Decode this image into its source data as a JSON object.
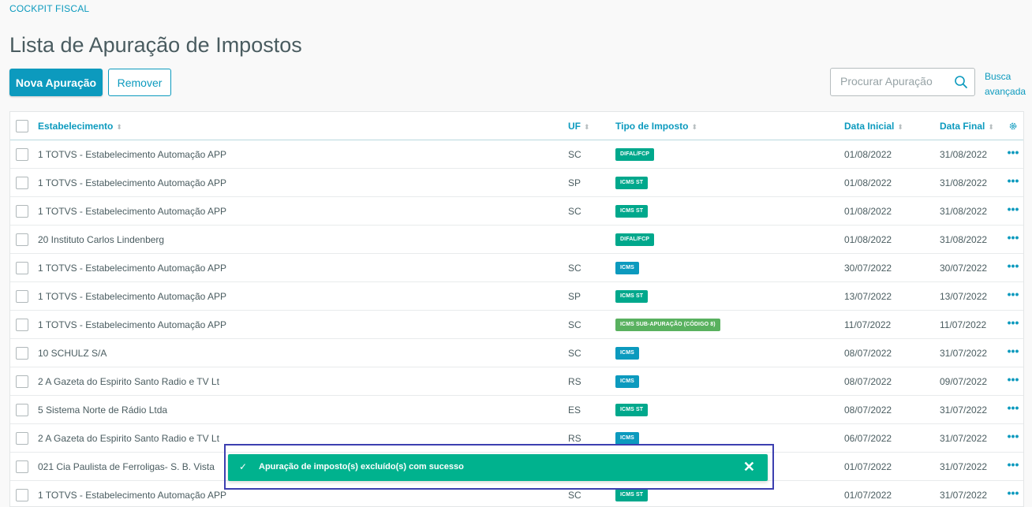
{
  "breadcrumb": "COCKPIT FISCAL",
  "page_title": "Lista de Apuração de Impostos",
  "actions": {
    "primary_label": "Nova Apuração",
    "secondary_label": "Remover"
  },
  "search": {
    "placeholder": "Procurar Apuração",
    "advanced_line1": "Busca",
    "advanced_line2": "avançada"
  },
  "table": {
    "columns": [
      "Estabelecimento",
      "UF",
      "Tipo de Imposto",
      "Data Inicial",
      "Data Final"
    ],
    "rows": [
      {
        "estabelecimento": "1 TOTVS - Estabelecimento Automação APP",
        "uf": "SC",
        "tipo": "DIFAL/FCP",
        "tipo_color": "#00a88c",
        "data_inicial": "01/08/2022",
        "data_final": "31/08/2022"
      },
      {
        "estabelecimento": "1 TOTVS - Estabelecimento Automação APP",
        "uf": "SP",
        "tipo": "ICMS ST",
        "tipo_color": "#00a88c",
        "data_inicial": "01/08/2022",
        "data_final": "31/08/2022"
      },
      {
        "estabelecimento": "1 TOTVS - Estabelecimento Automação APP",
        "uf": "SC",
        "tipo": "ICMS ST",
        "tipo_color": "#00a88c",
        "data_inicial": "01/08/2022",
        "data_final": "31/08/2022"
      },
      {
        "estabelecimento": "20 Instituto Carlos Lindenberg",
        "uf": "",
        "tipo": "DIFAL/FCP",
        "tipo_color": "#00a88c",
        "data_inicial": "01/08/2022",
        "data_final": "31/08/2022"
      },
      {
        "estabelecimento": "1 TOTVS - Estabelecimento Automação APP",
        "uf": "SC",
        "tipo": "ICMS",
        "tipo_color": "#0c9abe",
        "data_inicial": "30/07/2022",
        "data_final": "30/07/2022"
      },
      {
        "estabelecimento": "1 TOTVS - Estabelecimento Automação APP",
        "uf": "SP",
        "tipo": "ICMS ST",
        "tipo_color": "#00a88c",
        "data_inicial": "13/07/2022",
        "data_final": "13/07/2022"
      },
      {
        "estabelecimento": "1 TOTVS - Estabelecimento Automação APP",
        "uf": "SC",
        "tipo": "ICMS SUB-APURAÇÃO (CÓDIGO 8)",
        "tipo_color": "#59b15f",
        "data_inicial": "11/07/2022",
        "data_final": "11/07/2022"
      },
      {
        "estabelecimento": "10 SCHULZ S/A",
        "uf": "SC",
        "tipo": "ICMS",
        "tipo_color": "#0c9abe",
        "data_inicial": "08/07/2022",
        "data_final": "31/07/2022"
      },
      {
        "estabelecimento": "2 A Gazeta do Espirito Santo Radio e TV Lt",
        "uf": "RS",
        "tipo": "ICMS",
        "tipo_color": "#0c9abe",
        "data_inicial": "08/07/2022",
        "data_final": "09/07/2022"
      },
      {
        "estabelecimento": "5 Sistema Norte de Rádio Ltda",
        "uf": "ES",
        "tipo": "ICMS ST",
        "tipo_color": "#00a88c",
        "data_inicial": "08/07/2022",
        "data_final": "31/07/2022"
      },
      {
        "estabelecimento": "2 A Gazeta do Espirito Santo Radio e TV Lt",
        "uf": "RS",
        "tipo": "ICMS",
        "tipo_color": "#0c9abe",
        "data_inicial": "06/07/2022",
        "data_final": "31/07/2022"
      },
      {
        "estabelecimento": "021 Cia Paulista de Ferroligas- S. B. Vista",
        "uf": "",
        "tipo": "",
        "tipo_color": "#00a88c",
        "data_inicial": "01/07/2022",
        "data_final": "31/07/2022"
      },
      {
        "estabelecimento": "1 TOTVS - Estabelecimento Automação APP",
        "uf": "SC",
        "tipo": "ICMS ST",
        "tipo_color": "#00a88c",
        "data_inicial": "01/07/2022",
        "data_final": "31/07/2022"
      }
    ]
  },
  "toast": {
    "message": "Apuração de imposto(s) excluído(s) com sucesso"
  },
  "icons": {
    "search": "search-icon",
    "settings": "gear-icon",
    "row_actions": "more-icon",
    "toast_check": "check-icon",
    "toast_close": "close-icon"
  }
}
